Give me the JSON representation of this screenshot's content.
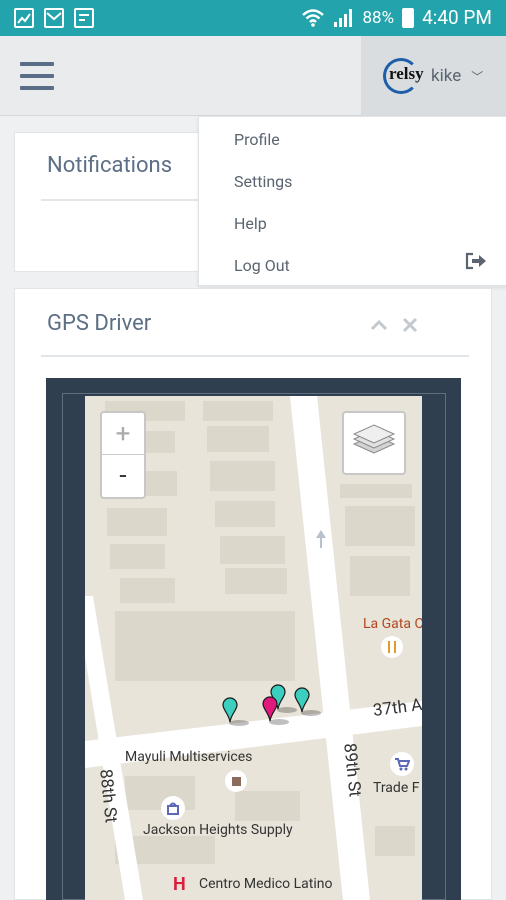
{
  "status_bar": {
    "battery": "88%",
    "time": "4:40 PM"
  },
  "header": {
    "username": "kike",
    "logo_text": "relsy"
  },
  "user_menu": {
    "items": [
      "Profile",
      "Settings",
      "Help",
      "Log Out"
    ]
  },
  "notifications_panel": {
    "title": "Notifications"
  },
  "gps_panel": {
    "title": "GPS Driver"
  },
  "map": {
    "zoom_in": "+",
    "zoom_out": "-",
    "labels": {
      "la_gata": "La Gata C",
      "street_37th": "37th A",
      "mayuli": "Mayuli Multiservices",
      "st_88th": "88th St",
      "st_89th": "89th St",
      "trade": "Trade F",
      "jackson": "Jackson Heights Supply",
      "centro": "Centro Medico Latino"
    },
    "markers": [
      {
        "color": "#3ccfc0"
      },
      {
        "color": "#3ccfc0"
      },
      {
        "color": "#e0197d"
      },
      {
        "color": "#3ccfc0"
      }
    ]
  }
}
